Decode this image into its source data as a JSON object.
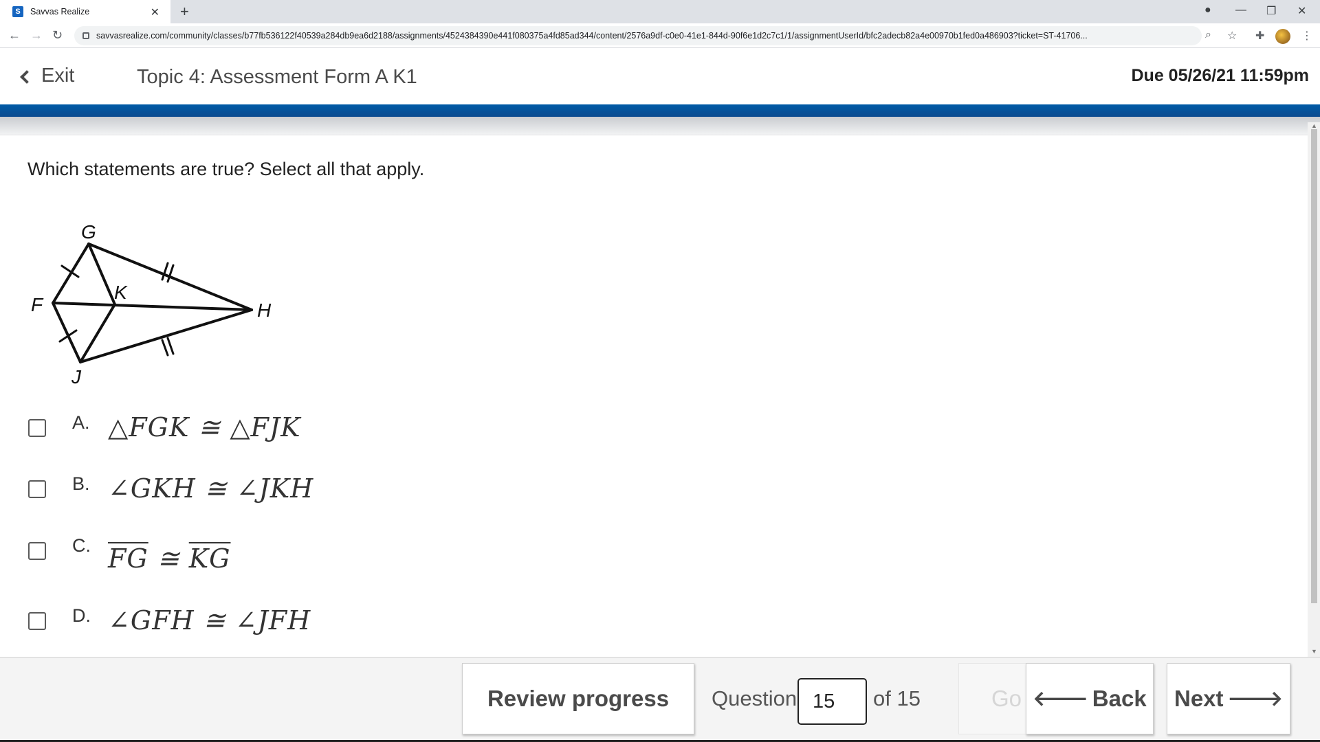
{
  "browser": {
    "tab_title": "Savvas Realize",
    "favicon_glyph": "S",
    "url": "savvasrealize.com/community/classes/b77fb536122f40539a284db9ea6d2188/assignments/4524384390e441f080375a4fd85ad344/content/2576a9df-c0e0-41e1-844d-90f6e1d2c7c1/1/assignmentUserId/bfc2adecb82a4e00970b1fed0a486903?ticket=ST-41706..."
  },
  "header": {
    "exit_label": "Exit",
    "assignment_title": "Topic 4: Assessment Form A K1",
    "due": "Due 05/26/21 11:59pm"
  },
  "question": {
    "prompt": "Which statements are true? Select all that apply.",
    "figure_labels": {
      "G": "G",
      "F": "F",
      "K": "K",
      "H": "H",
      "J": "J"
    },
    "choices": [
      {
        "letter": "A.",
        "statement": "△FGK ≅ △FJK"
      },
      {
        "letter": "B.",
        "statement": "∠GKH ≅ ∠JKH"
      },
      {
        "letter": "C.",
        "seg1": "FG",
        "cong": " ≅ ",
        "seg2": "KG"
      },
      {
        "letter": "D.",
        "statement": "∠GFH ≅ ∠JFH"
      }
    ]
  },
  "footer": {
    "review_label": "Review progress",
    "question_label": "Question",
    "question_value": "15",
    "of_label": "of 15",
    "go_label": "Go",
    "back_label": "Back",
    "next_label": "Next"
  },
  "colors": {
    "header_band": "#005aa6",
    "text": "#4a4a4a"
  }
}
